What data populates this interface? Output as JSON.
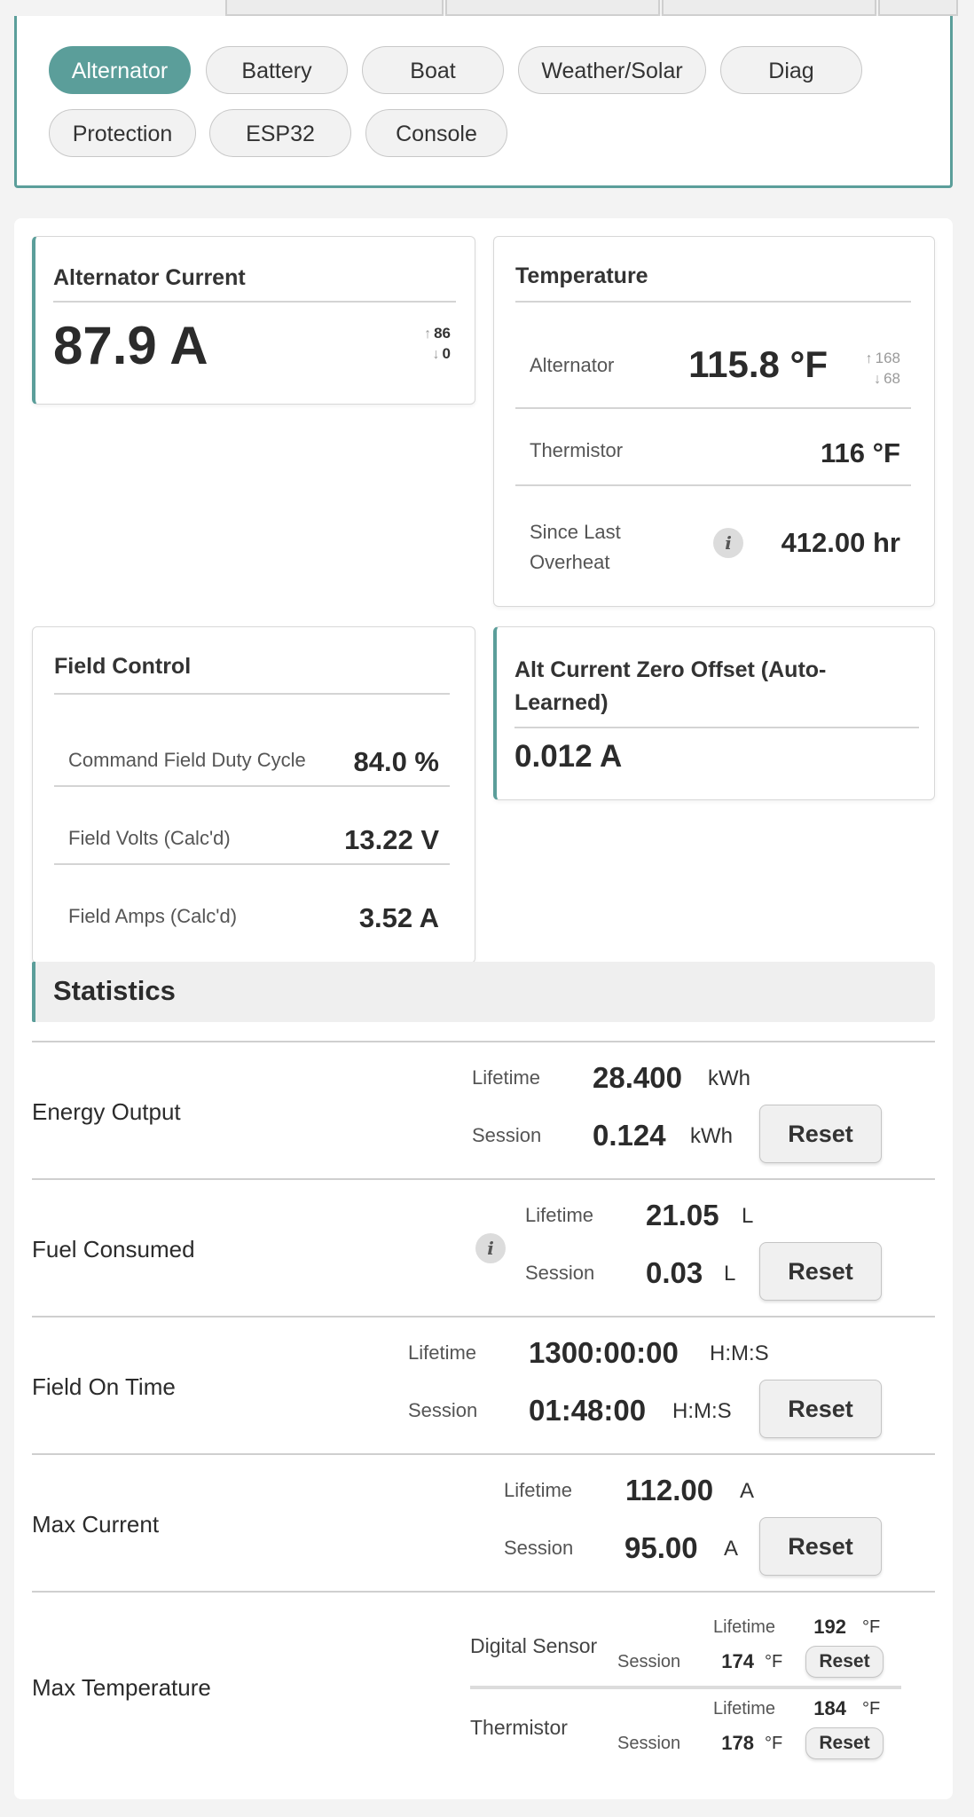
{
  "subnav": {
    "pills": [
      "Alternator",
      "Battery",
      "Boat",
      "Weather/Solar",
      "Diag",
      "Protection",
      "ESP32",
      "Console"
    ],
    "active": "Alternator"
  },
  "alt_current": {
    "title": "Alternator Current",
    "value": "87.9 A",
    "max": "86",
    "min": "0"
  },
  "temperature": {
    "title": "Temperature",
    "rows": [
      {
        "label": "Alternator",
        "value": "115.8 °F",
        "max": "168",
        "min": "68"
      },
      {
        "label": "Thermistor",
        "value": "116 °F"
      },
      {
        "label_line1": "Since Last",
        "label_line2": "Overheat",
        "value": "412.00 hr"
      }
    ]
  },
  "field_control": {
    "title": "Field Control",
    "rows": [
      {
        "label": "Command Field Duty Cycle",
        "value": "84.0 %"
      },
      {
        "label": "Field Volts (Calc'd)",
        "value": "13.22 V"
      },
      {
        "label": "Field Amps (Calc'd)",
        "value": "3.52 A"
      }
    ]
  },
  "zero_offset": {
    "title_line1": "Alt Current Zero Offset (Auto-",
    "title_line2": "Learned)",
    "value": "0.012 A"
  },
  "statistics": {
    "title": "Statistics",
    "lifetime_label": "Lifetime",
    "session_label": "Session",
    "reset_label": "Reset",
    "rows": [
      {
        "name": "Energy Output",
        "lifetime": "28.400",
        "session": "0.124",
        "unit": "kWh"
      },
      {
        "name": "Fuel Consumed",
        "lifetime": "21.05",
        "session": "0.03",
        "unit": "L"
      },
      {
        "name": "Field On Time",
        "lifetime": "1300:00:00",
        "session": "01:48:00",
        "unit": "H:M:S"
      },
      {
        "name": "Max Current",
        "lifetime": "112.00",
        "session": "95.00",
        "unit": "A"
      }
    ],
    "max_temp": {
      "name": "Max Temperature",
      "unit": "°F",
      "sensors": [
        {
          "name": "Digital Sensor",
          "lifetime": "192",
          "session": "174"
        },
        {
          "name": "Thermistor",
          "lifetime": "184",
          "session": "178"
        }
      ]
    }
  },
  "icons": {
    "info": "i",
    "up_arrow": "↑",
    "down_arrow": "↓"
  },
  "colors": {
    "accent": "#5b9e9a"
  }
}
